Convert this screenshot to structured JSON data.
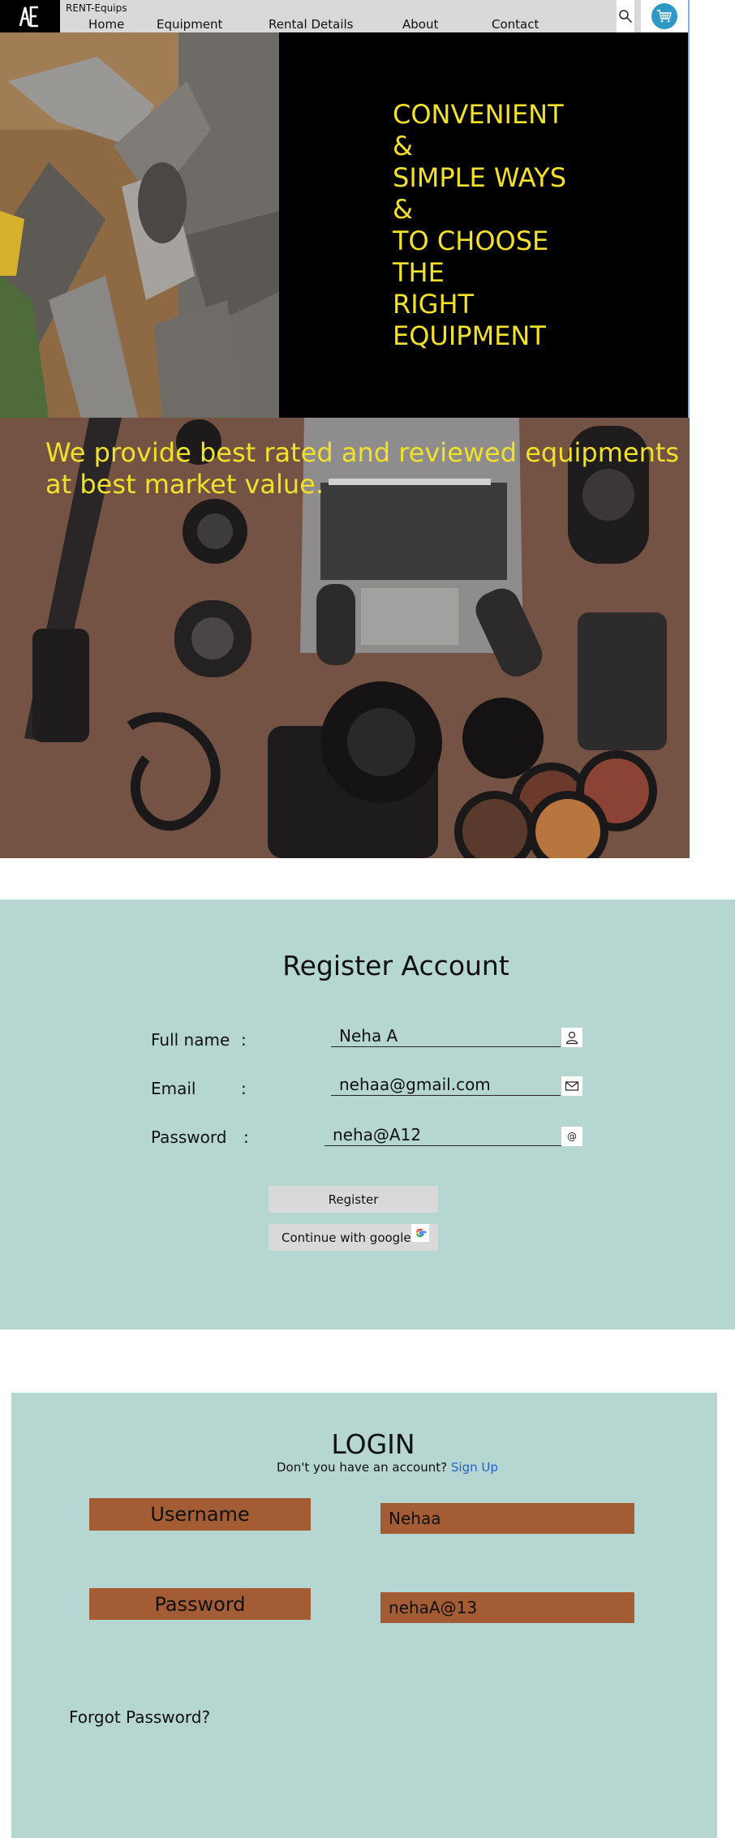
{
  "nav": {
    "brand": "RENT-Equips",
    "links": [
      "Home",
      "Equipment",
      "Rental Details",
      "About",
      "Contact"
    ],
    "logo_icon": "ae-logo",
    "search_icon": "search-icon",
    "cart_icon": "cart-icon",
    "cart_color": "#2e98c7"
  },
  "hero1": {
    "lines": [
      "CONVENIENT",
      "&",
      "SIMPLE WAYS",
      "&",
      "TO CHOOSE",
      "THE",
      "RIGHT",
      "EQUIPMENT"
    ],
    "text_color": "#f2e12b"
  },
  "hero2": {
    "tagline": "We provide best rated and reviewed equipments at best market value."
  },
  "register": {
    "title": "Register Account",
    "fields": [
      {
        "label": "Full name",
        "value": "Neha A",
        "icon": "user-icon"
      },
      {
        "label": "Email",
        "value": "nehaa@gmail.com",
        "icon": "mail-icon"
      },
      {
        "label": "Password",
        "value": "neha@A12",
        "icon": "at-icon"
      }
    ],
    "colon": ":",
    "at_symbol": "@",
    "register_button": "Register",
    "google_button": "Continue with google",
    "background": "#b6d6d1"
  },
  "login": {
    "title": "LOGIN",
    "prompt": "Don't you have an account?",
    "signup_link": "Sign Up",
    "username_label": "Username",
    "username_value": "Nehaa",
    "password_label": "Password",
    "password_value": "nehaA@13",
    "forgot": "Forgot Password?",
    "accent": "#a45c35"
  }
}
